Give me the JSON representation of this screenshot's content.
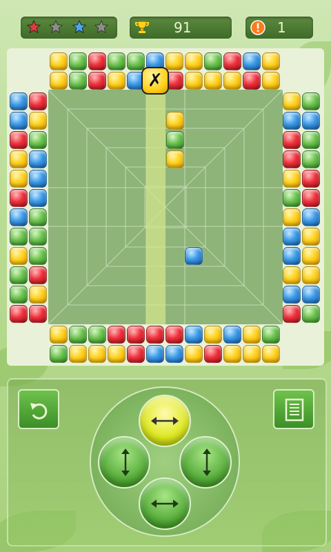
{
  "status": {
    "stars": [
      {
        "name": "red-star-icon",
        "color": "#e23a3a"
      },
      {
        "name": "gray-star-icon",
        "color": "#8a8f88"
      },
      {
        "name": "blue-star-icon",
        "color": "#4aa7f0"
      },
      {
        "name": "gray-star-icon",
        "color": "#8a8f88"
      }
    ],
    "score": "91",
    "warnings": "1",
    "score_icon": "trophy-icon",
    "warning_icon": "exclamation-icon"
  },
  "board": {
    "top_row_1": [
      "y",
      "g",
      "r",
      "g",
      "g",
      "b",
      "y",
      "y",
      "g",
      "r",
      "b",
      "y"
    ],
    "top_row_2": [
      "y",
      "g",
      "r",
      "y",
      "b",
      "y",
      "r",
      "y",
      "y",
      "y",
      "r",
      "y"
    ],
    "bottom_row_1": [
      "y",
      "g",
      "g",
      "r",
      "r",
      "r",
      "r",
      "b",
      "y",
      "b",
      "y",
      "g"
    ],
    "bottom_row_2": [
      "g",
      "y",
      "y",
      "y",
      "r",
      "b",
      "b",
      "y",
      "r",
      "y",
      "y",
      "y"
    ],
    "left_col_1": [
      "b",
      "b",
      "r",
      "y",
      "y",
      "r",
      "b",
      "g",
      "y",
      "g",
      "g",
      "r"
    ],
    "left_col_2": [
      "r",
      "y",
      "g",
      "b",
      "b",
      "b",
      "g",
      "g",
      "g",
      "r",
      "y",
      "r"
    ],
    "right_col_1": [
      "y",
      "b",
      "r",
      "r",
      "y",
      "g",
      "y",
      "b",
      "b",
      "y",
      "b",
      "r"
    ],
    "right_col_2": [
      "g",
      "b",
      "g",
      "g",
      "r",
      "r",
      "b",
      "y",
      "y",
      "y",
      "b",
      "g"
    ],
    "falling": [
      "y",
      "g",
      "y"
    ],
    "falling_bomb": "✗",
    "stray_gem": "b"
  },
  "controls": {
    "undo_icon": "undo-icon",
    "menu_icon": "list-menu-icon",
    "dpad": [
      "horizontal-arrows-icon",
      "vertical-arrows-icon",
      "vertical-arrows-icon",
      "horizontal-arrows-icon"
    ]
  },
  "colors": {
    "accent": "#4aa32e",
    "panel": "#3e6b28",
    "highlight": "#dde81e"
  }
}
